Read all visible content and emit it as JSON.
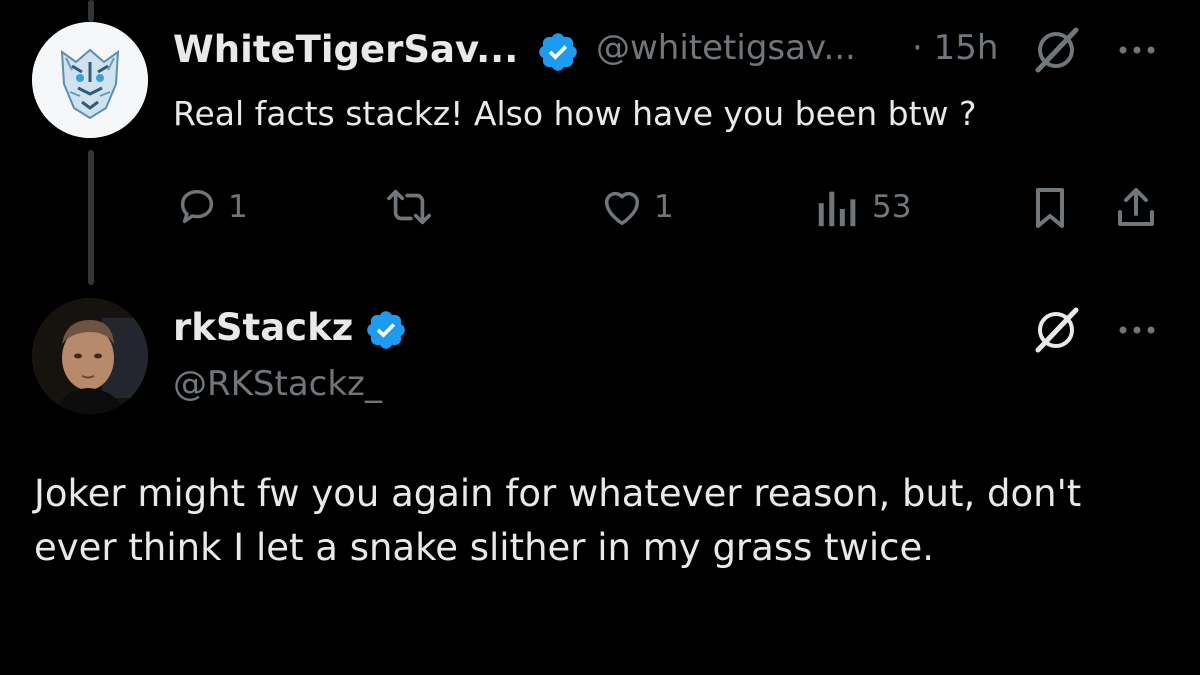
{
  "reply": {
    "display_name": "WhiteTigerSav...",
    "handle": "@whitetigsav...",
    "time": "· 15h",
    "text": "Real facts stackz! Also how have you been btw ?",
    "actions": {
      "replies": "1",
      "likes": "1",
      "views": "53"
    }
  },
  "main": {
    "display_name": "rkStackz",
    "handle": "@RKStackz_",
    "text": "Joker might fw you again for whatever reason, but, don't ever think I let a snake slither in my grass twice."
  },
  "colors": {
    "background": "#000000",
    "text": "#e7e9ea",
    "muted": "#71767b",
    "verified": "#1d9bf0",
    "thread_line": "#333639"
  }
}
